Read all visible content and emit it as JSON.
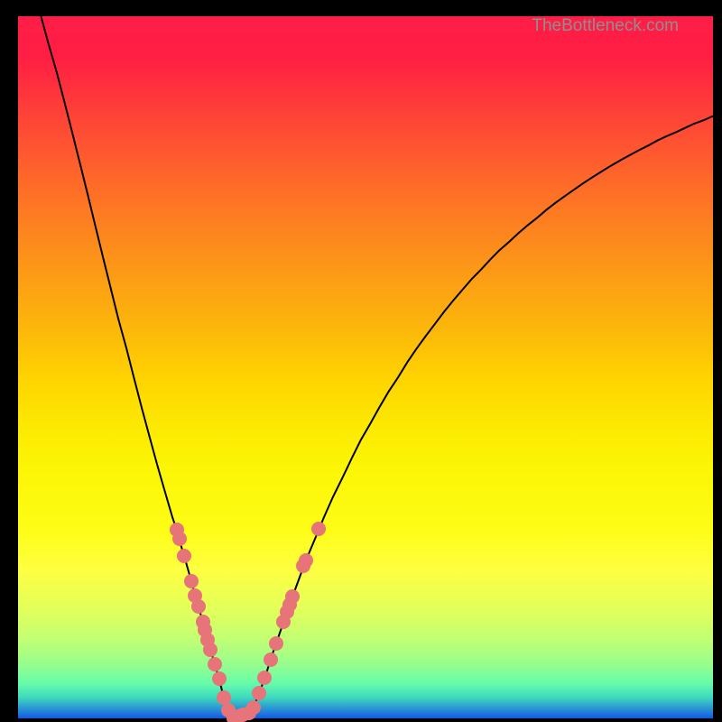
{
  "watermark": "TheBottleneck.com",
  "chart_data": {
    "type": "line",
    "title": "",
    "xlabel": "",
    "ylabel": "",
    "xlim": [
      0,
      100
    ],
    "ylim": [
      0,
      100
    ],
    "curve": [
      {
        "x": 3.3,
        "y": 100.0
      },
      {
        "x": 4.4,
        "y": 96.0
      },
      {
        "x": 5.6,
        "y": 91.9
      },
      {
        "x": 6.7,
        "y": 87.7
      },
      {
        "x": 7.8,
        "y": 83.4
      },
      {
        "x": 8.9,
        "y": 79.1
      },
      {
        "x": 10.0,
        "y": 74.7
      },
      {
        "x": 11.1,
        "y": 70.2
      },
      {
        "x": 12.2,
        "y": 65.8
      },
      {
        "x": 13.3,
        "y": 61.4
      },
      {
        "x": 14.4,
        "y": 57.0
      },
      {
        "x": 15.6,
        "y": 52.7
      },
      {
        "x": 16.7,
        "y": 48.4
      },
      {
        "x": 17.8,
        "y": 44.2
      },
      {
        "x": 18.9,
        "y": 40.2
      },
      {
        "x": 20.0,
        "y": 36.2
      },
      {
        "x": 21.1,
        "y": 32.4
      },
      {
        "x": 22.2,
        "y": 28.7
      },
      {
        "x": 22.8,
        "y": 26.9
      },
      {
        "x": 23.3,
        "y": 25.1
      },
      {
        "x": 24.0,
        "y": 22.8
      },
      {
        "x": 24.8,
        "y": 20.0
      },
      {
        "x": 25.6,
        "y": 17.2
      },
      {
        "x": 26.4,
        "y": 14.4
      },
      {
        "x": 27.0,
        "y": 12.3
      },
      {
        "x": 27.6,
        "y": 10.2
      },
      {
        "x": 28.3,
        "y": 7.7
      },
      {
        "x": 29.0,
        "y": 5.4
      },
      {
        "x": 29.6,
        "y": 2.9
      },
      {
        "x": 30.4,
        "y": 0.4
      },
      {
        "x": 31.0,
        "y": 0.0
      },
      {
        "x": 31.5,
        "y": 0.1
      },
      {
        "x": 32.0,
        "y": 0.2
      },
      {
        "x": 32.9,
        "y": 0.5
      },
      {
        "x": 33.8,
        "y": 1.4
      },
      {
        "x": 34.7,
        "y": 3.6
      },
      {
        "x": 35.6,
        "y": 6.0
      },
      {
        "x": 36.4,
        "y": 8.6
      },
      {
        "x": 37.3,
        "y": 11.1
      },
      {
        "x": 38.2,
        "y": 13.7
      },
      {
        "x": 39.1,
        "y": 16.2
      },
      {
        "x": 40.0,
        "y": 18.7
      },
      {
        "x": 41.3,
        "y": 22.2
      },
      {
        "x": 42.7,
        "y": 25.5
      },
      {
        "x": 44.0,
        "y": 28.6
      },
      {
        "x": 45.3,
        "y": 31.5
      },
      {
        "x": 46.7,
        "y": 34.3
      },
      {
        "x": 48.0,
        "y": 37.0
      },
      {
        "x": 49.3,
        "y": 39.6
      },
      {
        "x": 50.7,
        "y": 42.0
      },
      {
        "x": 52.0,
        "y": 44.3
      },
      {
        "x": 53.3,
        "y": 46.5
      },
      {
        "x": 54.7,
        "y": 48.6
      },
      {
        "x": 56.0,
        "y": 50.7
      },
      {
        "x": 57.3,
        "y": 52.6
      },
      {
        "x": 58.7,
        "y": 54.5
      },
      {
        "x": 60.0,
        "y": 56.2
      },
      {
        "x": 61.3,
        "y": 57.9
      },
      {
        "x": 62.7,
        "y": 59.6
      },
      {
        "x": 64.0,
        "y": 61.1
      },
      {
        "x": 65.3,
        "y": 62.6
      },
      {
        "x": 66.7,
        "y": 64.0
      },
      {
        "x": 68.0,
        "y": 65.4
      },
      {
        "x": 69.3,
        "y": 66.7
      },
      {
        "x": 70.7,
        "y": 67.9
      },
      {
        "x": 72.0,
        "y": 69.1
      },
      {
        "x": 73.3,
        "y": 70.2
      },
      {
        "x": 74.7,
        "y": 71.3
      },
      {
        "x": 76.0,
        "y": 72.4
      },
      {
        "x": 77.3,
        "y": 73.4
      },
      {
        "x": 78.7,
        "y": 74.4
      },
      {
        "x": 80.0,
        "y": 75.3
      },
      {
        "x": 81.3,
        "y": 76.2
      },
      {
        "x": 82.7,
        "y": 77.1
      },
      {
        "x": 84.0,
        "y": 77.9
      },
      {
        "x": 85.3,
        "y": 78.7
      },
      {
        "x": 86.7,
        "y": 79.5
      },
      {
        "x": 88.0,
        "y": 80.2
      },
      {
        "x": 89.3,
        "y": 80.9
      },
      {
        "x": 90.7,
        "y": 81.6
      },
      {
        "x": 92.0,
        "y": 82.3
      },
      {
        "x": 93.3,
        "y": 82.9
      },
      {
        "x": 94.7,
        "y": 83.5
      },
      {
        "x": 96.0,
        "y": 84.1
      },
      {
        "x": 97.3,
        "y": 84.7
      },
      {
        "x": 98.7,
        "y": 85.2
      },
      {
        "x": 100.0,
        "y": 85.8
      }
    ],
    "scatter": [
      {
        "x": 22.8,
        "y": 26.9
      },
      {
        "x": 23.2,
        "y": 25.6
      },
      {
        "x": 23.9,
        "y": 23.1
      },
      {
        "x": 24.9,
        "y": 19.6
      },
      {
        "x": 25.5,
        "y": 17.5
      },
      {
        "x": 26.0,
        "y": 15.9
      },
      {
        "x": 26.6,
        "y": 13.8
      },
      {
        "x": 26.9,
        "y": 12.6
      },
      {
        "x": 27.3,
        "y": 11.2
      },
      {
        "x": 27.7,
        "y": 9.8
      },
      {
        "x": 28.3,
        "y": 7.7
      },
      {
        "x": 28.9,
        "y": 5.6
      },
      {
        "x": 29.6,
        "y": 3.0
      },
      {
        "x": 30.2,
        "y": 1.1
      },
      {
        "x": 31.0,
        "y": 0.0
      },
      {
        "x": 31.7,
        "y": 0.3
      },
      {
        "x": 32.4,
        "y": 0.5
      },
      {
        "x": 33.2,
        "y": 0.8
      },
      {
        "x": 33.9,
        "y": 1.6
      },
      {
        "x": 34.7,
        "y": 3.6
      },
      {
        "x": 35.5,
        "y": 5.8
      },
      {
        "x": 36.3,
        "y": 8.4
      },
      {
        "x": 37.1,
        "y": 10.7
      },
      {
        "x": 38.2,
        "y": 13.7
      },
      {
        "x": 38.7,
        "y": 15.2
      },
      {
        "x": 39.1,
        "y": 16.2
      },
      {
        "x": 39.5,
        "y": 17.3
      },
      {
        "x": 41.1,
        "y": 21.7
      },
      {
        "x": 41.4,
        "y": 22.5
      },
      {
        "x": 43.3,
        "y": 27.0
      }
    ]
  }
}
